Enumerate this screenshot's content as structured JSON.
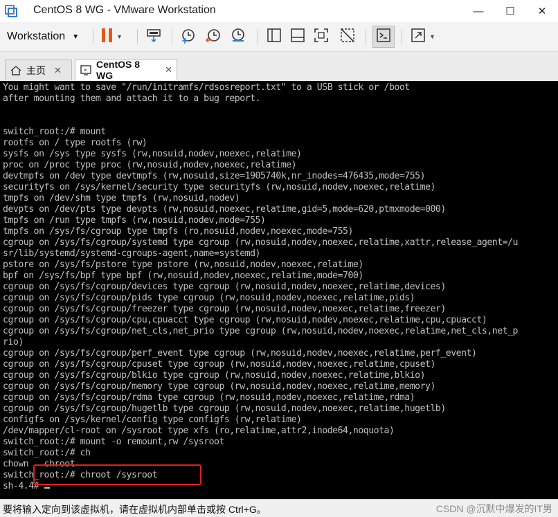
{
  "window": {
    "title": "CentOS 8 WG - VMware Workstation",
    "minimize_glyph": "—",
    "maximize_glyph": "☐",
    "close_glyph": "✕"
  },
  "toolbar": {
    "workstation_label": "Workstation",
    "icons": [
      "pause-icon",
      "send-keys-icon",
      "snapshot-icon",
      "revert-snapshot-icon",
      "snapshot-manager-icon",
      "library-view-icon",
      "console-view-icon",
      "fullscreen-icon",
      "unity-icon",
      "terminal-icon",
      "stretch-icon"
    ]
  },
  "tabs": [
    {
      "label": "主页",
      "close": "✕"
    },
    {
      "label": "CentOS 8 WG",
      "close": "✕"
    }
  ],
  "console": {
    "lines": [
      "You might want to save \"/run/initramfs/rdsosreport.txt\" to a USB stick or /boot",
      "after mounting them and attach it to a bug report.",
      "",
      "",
      "switch_root:/# mount",
      "rootfs on / type rootfs (rw)",
      "sysfs on /sys type sysfs (rw,nosuid,nodev,noexec,relatime)",
      "proc on /proc type proc (rw,nosuid,nodev,noexec,relatime)",
      "devtmpfs on /dev type devtmpfs (rw,nosuid,size=1905740k,nr_inodes=476435,mode=755)",
      "securityfs on /sys/kernel/security type securityfs (rw,nosuid,nodev,noexec,relatime)",
      "tmpfs on /dev/shm type tmpfs (rw,nosuid,nodev)",
      "devpts on /dev/pts type devpts (rw,nosuid,noexec,relatime,gid=5,mode=620,ptmxmode=000)",
      "tmpfs on /run type tmpfs (rw,nosuid,nodev,mode=755)",
      "tmpfs on /sys/fs/cgroup type tmpfs (ro,nosuid,nodev,noexec,mode=755)",
      "cgroup on /sys/fs/cgroup/systemd type cgroup (rw,nosuid,nodev,noexec,relatime,xattr,release_agent=/u",
      "sr/lib/systemd/systemd-cgroups-agent,name=systemd)",
      "pstore on /sys/fs/pstore type pstore (rw,nosuid,nodev,noexec,relatime)",
      "bpf on /sys/fs/bpf type bpf (rw,nosuid,nodev,noexec,relatime,mode=700)",
      "cgroup on /sys/fs/cgroup/devices type cgroup (rw,nosuid,nodev,noexec,relatime,devices)",
      "cgroup on /sys/fs/cgroup/pids type cgroup (rw,nosuid,nodev,noexec,relatime,pids)",
      "cgroup on /sys/fs/cgroup/freezer type cgroup (rw,nosuid,nodev,noexec,relatime,freezer)",
      "cgroup on /sys/fs/cgroup/cpu,cpuacct type cgroup (rw,nosuid,nodev,noexec,relatime,cpu,cpuacct)",
      "cgroup on /sys/fs/cgroup/net_cls,net_prio type cgroup (rw,nosuid,nodev,noexec,relatime,net_cls,net_p",
      "rio)",
      "cgroup on /sys/fs/cgroup/perf_event type cgroup (rw,nosuid,nodev,noexec,relatime,perf_event)",
      "cgroup on /sys/fs/cgroup/cpuset type cgroup (rw,nosuid,nodev,noexec,relatime,cpuset)",
      "cgroup on /sys/fs/cgroup/blkio type cgroup (rw,nosuid,nodev,noexec,relatime,blkio)",
      "cgroup on /sys/fs/cgroup/memory type cgroup (rw,nosuid,nodev,noexec,relatime,memory)",
      "cgroup on /sys/fs/cgroup/rdma type cgroup (rw,nosuid,nodev,noexec,relatime,rdma)",
      "cgroup on /sys/fs/cgroup/hugetlb type cgroup (rw,nosuid,nodev,noexec,relatime,hugetlb)",
      "configfs on /sys/kernel/config type configfs (rw,relatime)",
      "/dev/mapper/cl-root on /sysroot type xfs (ro,relatime,attr2,inode64,noquota)",
      "switch_root:/# mount -o remount,rw /sysroot",
      "switch_root:/# ch",
      "chown   chroot",
      "switch_root:/# chroot /sysroot"
    ],
    "prompt": "sh-4.4# "
  },
  "status": {
    "text": "要将输入定向到该虚拟机，请在虚拟机内部单击或按 Ctrl+G。",
    "watermark": "CSDN @沉默中爆发的IT男"
  },
  "colors": {
    "accent": "#e05a1c",
    "console_bg": "#000000",
    "console_fg": "#c0c0c0",
    "highlight_box": "#e02020"
  }
}
